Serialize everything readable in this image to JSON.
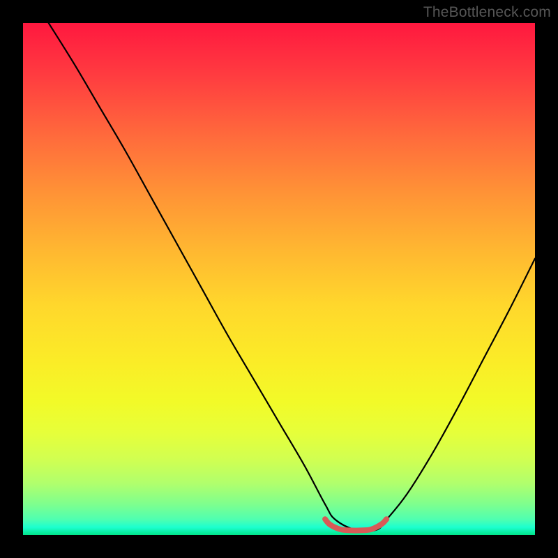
{
  "watermark": "TheBottleneck.com",
  "colors": {
    "background": "#000000",
    "curve_black": "#000000",
    "red_segment": "#D85A57",
    "gradient_top": "#ff183f",
    "gradient_bottom": "#00e58a"
  },
  "chart_data": {
    "type": "line",
    "title": "",
    "xlabel": "",
    "ylabel": "",
    "xlim": [
      0,
      100
    ],
    "ylim": [
      0,
      100
    ],
    "series": [
      {
        "name": "bottleneck-curve",
        "x": [
          5,
          10,
          15,
          20,
          25,
          30,
          35,
          40,
          45,
          50,
          55,
          59,
          61,
          65,
          69,
          71,
          75,
          80,
          85,
          90,
          95,
          100
        ],
        "values": [
          100,
          92,
          83.5,
          75,
          66,
          57,
          48,
          39,
          30.5,
          22,
          13.5,
          6,
          3,
          1,
          1,
          3,
          8,
          16,
          25,
          34.5,
          44,
          54
        ]
      },
      {
        "name": "highlighted-minimum",
        "x": [
          59,
          60,
          62,
          64,
          66,
          68,
          70,
          71
        ],
        "values": [
          3.1,
          2.0,
          1.1,
          0.9,
          0.9,
          1.1,
          2.1,
          3.1
        ]
      }
    ],
    "annotations": []
  }
}
